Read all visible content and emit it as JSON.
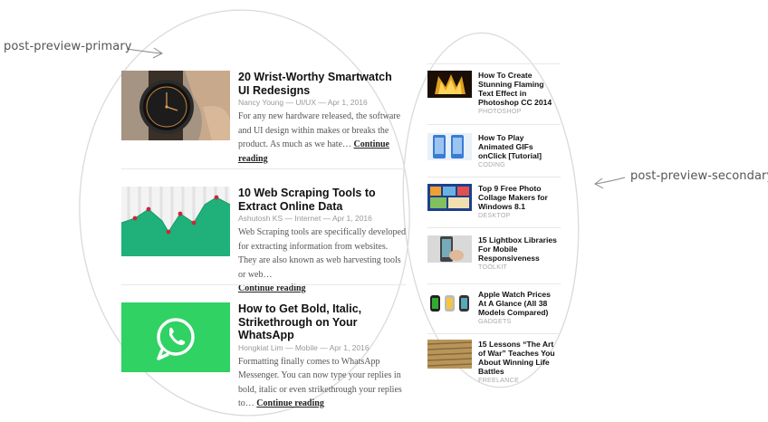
{
  "annotations": {
    "primary_label": "post-preview-primary",
    "secondary_label": "post-preview-secondary"
  },
  "primary_posts": [
    {
      "title": "20 Wrist-Worthy Smartwatch UI Redesigns",
      "meta": "Nancy Young — UI/UX — Apr 1, 2016",
      "excerpt": "For any new hardware released, the software and UI design within makes or breaks the product. As much as we hate…",
      "more": "Continue reading",
      "thumb": "smartwatch-image"
    },
    {
      "title": "10 Web Scraping Tools to Extract Online Data",
      "meta": "Ashutosh KS — Internet — Apr 1, 2016",
      "excerpt": "Web Scraping tools are specifically developed for extracting information from websites. They are also known as web harvesting tools or web…",
      "more": "Continue reading",
      "thumb": "green-chart-image"
    },
    {
      "title": "How to Get Bold, Italic, Strikethrough on Your WhatsApp",
      "meta": "Hongkiat Lim — Mobile — Apr 1, 2016",
      "excerpt": "Formatting finally comes to WhatsApp Messenger. You can now type your replies in bold, italic or even strikethrough your replies to…",
      "more": "Continue reading",
      "thumb": "whatsapp-logo"
    }
  ],
  "secondary_posts": [
    {
      "title": "How To Create Stunning Flaming Text Effect in Photoshop CC 2014",
      "category": "PHOTOSHOP"
    },
    {
      "title": "How To Play Animated GIFs onClick [Tutorial]",
      "category": "CODING"
    },
    {
      "title": "Top 9 Free Photo Collage Makers for Windows 8.1",
      "category": "DESKTOP"
    },
    {
      "title": "15 Lightbox Libraries For Mobile Responsiveness",
      "category": "TOOLKIT"
    },
    {
      "title": "Apple Watch Prices At A Glance (All 38 Models Compared)",
      "category": "GADGETS"
    },
    {
      "title": "15 Lessons “The Art of War” Teaches You About Winning Life Battles",
      "category": "FREELANCE"
    }
  ],
  "colors": {
    "whatsapp_green": "#2fd263",
    "chart_green": "#20b07a",
    "chart_dots": "#c8283a",
    "annotation_stroke": "#d8d8d8"
  }
}
